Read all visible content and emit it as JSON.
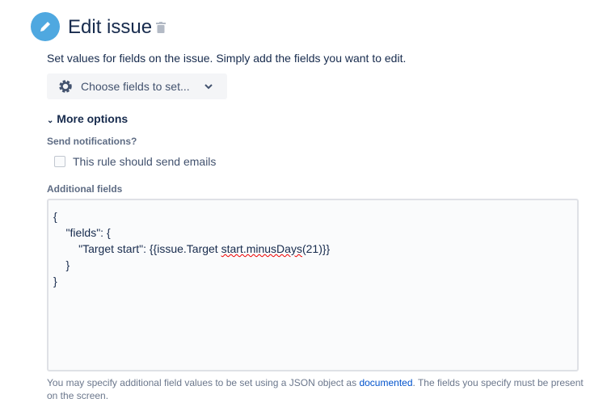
{
  "header": {
    "title": "Edit issue",
    "icon": "pencil-icon",
    "delete_icon": "trash-icon"
  },
  "description": "Set values for fields on the issue. Simply add the fields you want to edit.",
  "choose_fields": {
    "label": "Choose fields to set...",
    "icon": "gear-icon"
  },
  "more_options": "More options",
  "send_notifications": {
    "label": "Send notifications?",
    "checkbox_label": "This rule should send emails",
    "checked": false
  },
  "additional_fields": {
    "label": "Additional fields",
    "lines": [
      "{",
      "    \"fields\": {",
      "        \"Target start\": {{issue.Target ",
      "    }",
      "}"
    ],
    "line3_squiggly": "start.minusDays",
    "line3_tail": "(21)}}"
  },
  "help": {
    "before": "You may specify additional field values to be set using a JSON object as ",
    "link": "documented",
    "after": ". The fields you specify must be present on the screen."
  }
}
